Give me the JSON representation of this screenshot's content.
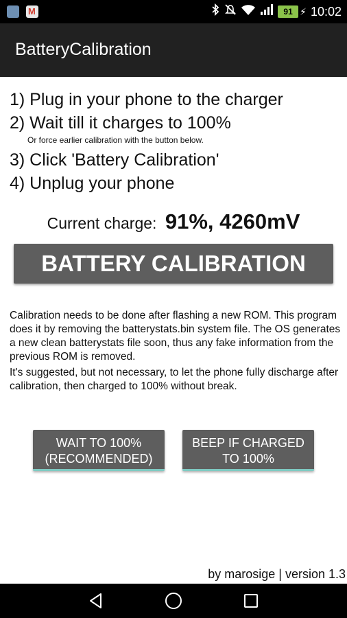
{
  "status_bar": {
    "left_icons": [
      "android-notification-icon",
      "gmail-icon"
    ],
    "right_icons": [
      "bluetooth-icon",
      "mute-icon",
      "wifi-icon",
      "signal-icon"
    ],
    "battery_level": "91",
    "time": "10:02"
  },
  "app_bar": {
    "title": "BatteryCalibration"
  },
  "instructions": {
    "step1": "1) Plug in your phone to the charger",
    "step2": "2) Wait till it charges to 100%",
    "step2_note": "Or force earlier calibration with the button below.",
    "step3": "3) Click 'Battery Calibration'",
    "step4": "4) Unplug your phone"
  },
  "charge": {
    "label": "Current charge:",
    "value": "91%, 4260mV"
  },
  "calibrate_button": {
    "label": "BATTERY CALIBRATION"
  },
  "description": {
    "para1": "Calibration needs to be done after flashing a new ROM. This program does it by removing the batterystats.bin system file. The OS generates a new clean batterystats file soon, thus any fake information from the previous ROM is removed.",
    "para2": "It's suggested, but not necessary, to let the phone fully discharge after calibration, then charged to 100% without break."
  },
  "options": {
    "wait_line1": "WAIT TO 100%",
    "wait_line2": "(RECOMMENDED)",
    "beep_line1": "BEEP IF CHARGED",
    "beep_line2": "TO 100%",
    "accent_color": "#7fcac2"
  },
  "footer": {
    "text": "by marosige | version 1.3"
  },
  "nav_bar": {
    "icons": [
      "back-icon",
      "home-icon",
      "recents-icon"
    ]
  }
}
